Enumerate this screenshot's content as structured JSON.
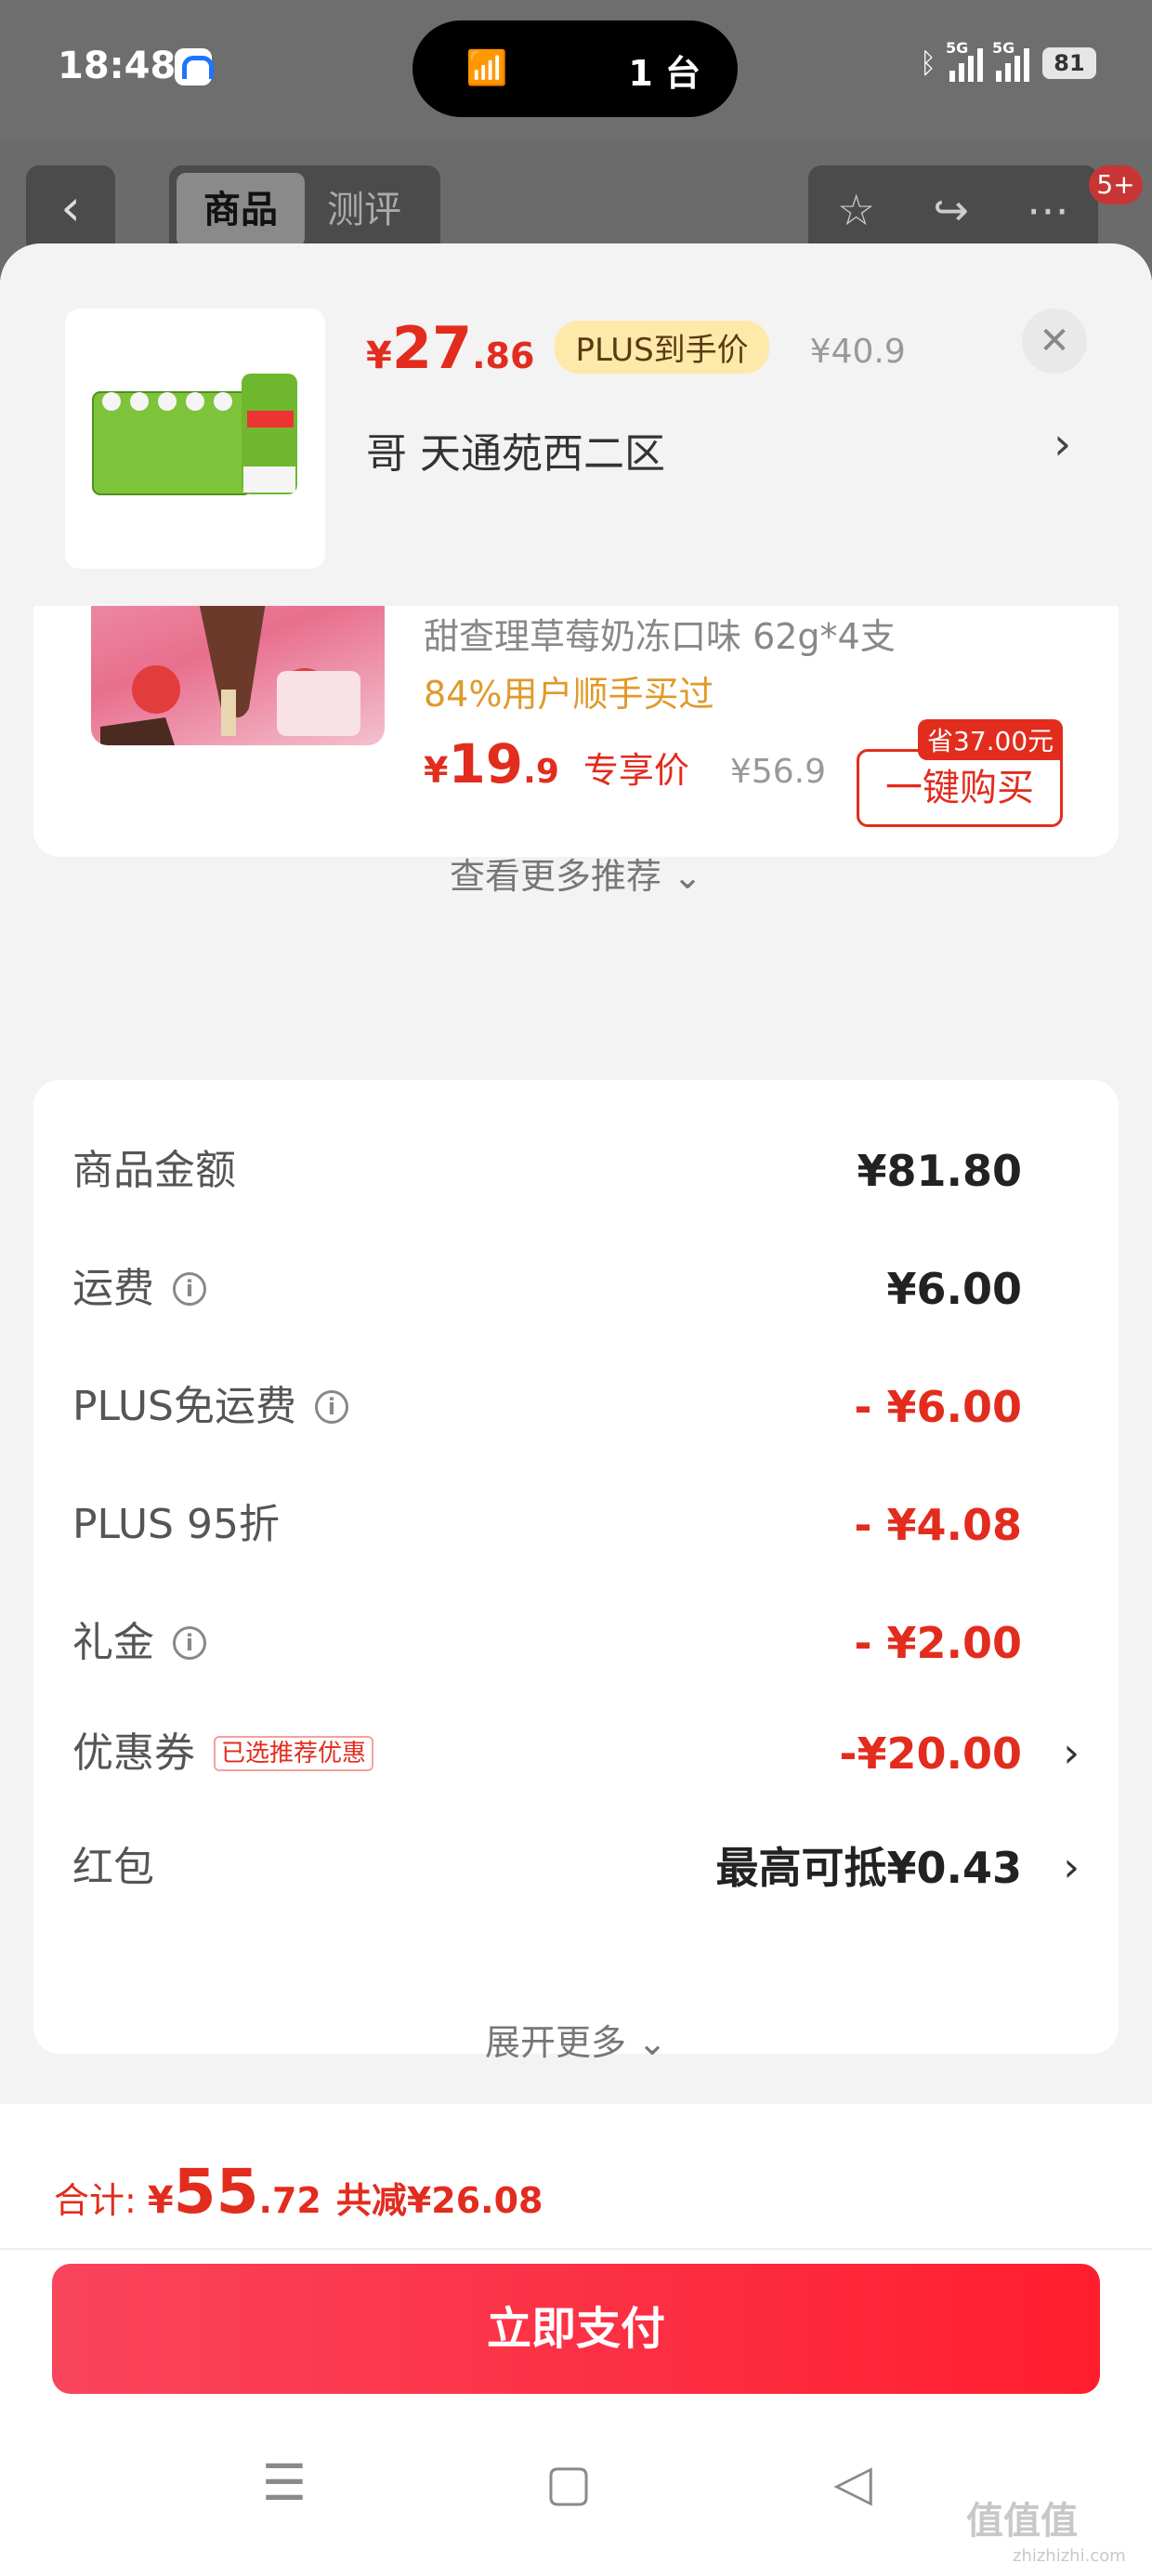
{
  "status_bar": {
    "time": "18:48",
    "pill_text": "1 台",
    "signal_labels": [
      "5G",
      "5G"
    ],
    "battery": "81"
  },
  "bg_nav": {
    "tabs": [
      "商品",
      "测评"
    ],
    "badge": "5+"
  },
  "sheet_header": {
    "price_currency": "¥",
    "price_int": "27",
    "price_dec": ".86",
    "plus_tag": "PLUS到手价",
    "original_price": "¥40.9",
    "address": "哥  天通苑西二区"
  },
  "recommendation": {
    "subtitle": "甜查理草莓奶冻口味 62g*4支",
    "bought_text": "84%用户顺手买过",
    "price_currency": "¥",
    "price_int": "19",
    "price_dec": ".9",
    "exclusive_label": "专享价",
    "original_price": "¥56.9",
    "save_tag": "省37.00元",
    "buy_button": "一键购买",
    "more_label": "查看更多推荐"
  },
  "fees": [
    {
      "label": "商品金额",
      "value": "¥81.80",
      "info": false,
      "red": false,
      "chevron": false,
      "tag": ""
    },
    {
      "label": "运费",
      "value": "¥6.00",
      "info": true,
      "red": false,
      "chevron": false,
      "tag": ""
    },
    {
      "label": "PLUS免运费",
      "value": "- ¥6.00",
      "info": true,
      "red": true,
      "chevron": false,
      "tag": ""
    },
    {
      "label": "PLUS 95折",
      "value": "- ¥4.08",
      "info": false,
      "red": true,
      "chevron": false,
      "tag": ""
    },
    {
      "label": "礼金",
      "value": "- ¥2.00",
      "info": true,
      "red": true,
      "chevron": false,
      "tag": ""
    },
    {
      "label": "优惠券",
      "value": "-¥20.00",
      "info": false,
      "red": true,
      "chevron": true,
      "tag": "已选推荐优惠"
    },
    {
      "label": "红包",
      "value": "最高可抵¥0.43",
      "info": false,
      "red": false,
      "chevron": true,
      "tag": ""
    }
  ],
  "expand_more": "展开更多",
  "bottom": {
    "total_label": "合计:",
    "total_currency": "¥",
    "total_int": "55",
    "total_dec": ".72",
    "discount_text": "共减¥26.08",
    "pay_button": "立即支付"
  },
  "watermark": {
    "main": "值值值",
    "sub": "zhizhizhi.com"
  },
  "colors": {
    "accent": "#e22c1e",
    "pay_button": "#ff2436",
    "plus_tag_bg": "#fde9a9"
  }
}
